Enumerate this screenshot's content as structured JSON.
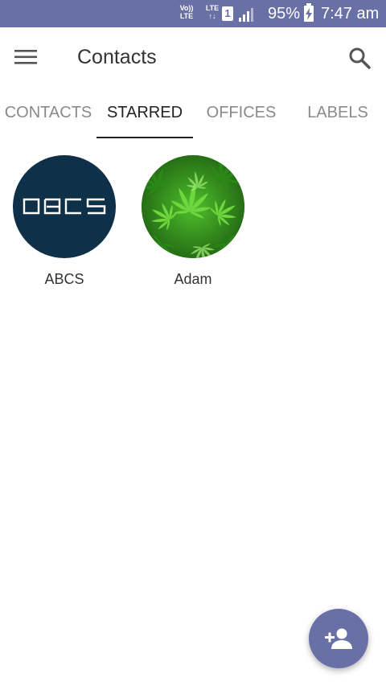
{
  "status_bar": {
    "volte_line1": "Vo))",
    "volte_line2": "LTE",
    "lte_label": "LTE",
    "lte_sub": "↑↓",
    "sim_slot": "1",
    "battery_percent": "95%",
    "time": "7:47 am",
    "background": "#6970a6"
  },
  "toolbar": {
    "title": "Contacts",
    "menu_icon": "hamburger-menu-icon",
    "search_icon": "search-icon"
  },
  "tabs": [
    {
      "label": "CONTACTS",
      "active": false
    },
    {
      "label": "STARRED",
      "active": true
    },
    {
      "label": "OFFICES",
      "active": false
    },
    {
      "label": "LABELS",
      "active": false
    }
  ],
  "starred_contacts": [
    {
      "name": "ABCS",
      "avatar_text": "ABCS",
      "avatar_color": "#0f3049"
    },
    {
      "name": "Adam",
      "avatar_image": "green-leaves-photo",
      "avatar_color": "#2f9a1e"
    }
  ],
  "fab": {
    "icon": "add-person-icon",
    "color": "#6970a6"
  }
}
